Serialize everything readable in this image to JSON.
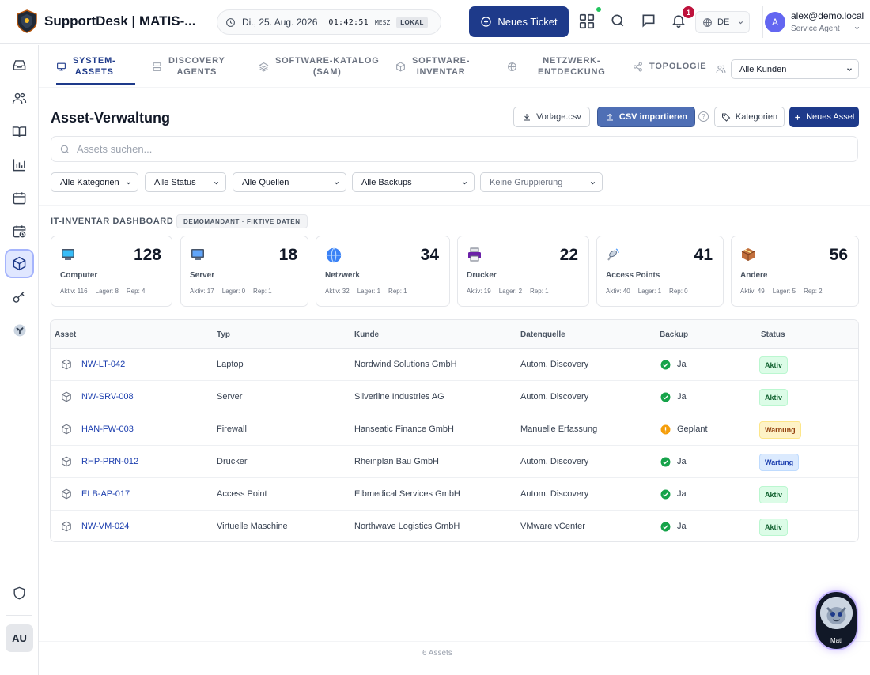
{
  "header": {
    "app_title": "SupportDesk | MATIS-...",
    "date": "Di., 25. Aug. 2026",
    "time": "01:42:51",
    "timezone": "MESZ",
    "local_label": "LOKAL",
    "new_ticket_label": "Neues Ticket",
    "notification_count": "1",
    "language": "DE",
    "user_avatar": "A",
    "user_email": "alex@demo.local",
    "user_role": "Service Agent"
  },
  "sidebar": {
    "items": [
      "inbox-icon",
      "users-icon",
      "book-icon",
      "chart-icon",
      "calendar-icon",
      "calendar-clock-icon",
      "cube-icon",
      "key-icon",
      "bot-icon"
    ],
    "bottom": [
      "shield-icon"
    ],
    "avatar": "AU"
  },
  "tabs": [
    {
      "line1": "SYSTEM-",
      "line2": "ASSETS",
      "icon": "monitor-icon",
      "active": true
    },
    {
      "line1": "DISCOVERY",
      "line2": "AGENTS",
      "icon": "server-icon"
    },
    {
      "line1": "SOFTWARE-KATALOG",
      "line2": "(SAM)",
      "icon": "layers-icon"
    },
    {
      "line1": "SOFTWARE-",
      "line2": "INVENTAR",
      "icon": "box-icon"
    },
    {
      "line1": "NETZWERK-",
      "line2": "ENTDECKUNG",
      "icon": "globe-icon"
    },
    {
      "line1": "TOPOLOGIE",
      "line2": "",
      "icon": "share-icon"
    }
  ],
  "customer_select": "Alle Kunden",
  "page": {
    "title": "Asset-Verwaltung",
    "btn_template": "Vorlage.csv",
    "btn_import": "CSV importieren",
    "help": "?",
    "btn_categories": "Kategorien",
    "btn_new_asset": "Neues Asset",
    "search_placeholder": "Assets suchen..."
  },
  "filters": [
    "Alle Kategorien",
    "Alle Status",
    "Alle Quellen",
    "Alle Backups",
    "Keine Gruppierung"
  ],
  "dashboard": {
    "title": "IT-INVENTAR DASHBOARD",
    "badge": "DEMOMANDANT · FIKTIVE DATEN",
    "cards": [
      {
        "label": "Computer",
        "count": "128",
        "aktiv": "Aktiv: 116",
        "lager": "Lager: 8",
        "rep": "Rep: 4",
        "icon": "computer-icon"
      },
      {
        "label": "Server",
        "count": "18",
        "aktiv": "Aktiv: 17",
        "lager": "Lager: 0",
        "rep": "Rep: 1",
        "icon": "server-monitor-icon"
      },
      {
        "label": "Netzwerk",
        "count": "34",
        "aktiv": "Aktiv: 32",
        "lager": "Lager: 1",
        "rep": "Rep: 1",
        "icon": "globe-icon"
      },
      {
        "label": "Drucker",
        "count": "22",
        "aktiv": "Aktiv: 19",
        "lager": "Lager: 2",
        "rep": "Rep: 1",
        "icon": "printer-icon"
      },
      {
        "label": "Access Points",
        "count": "41",
        "aktiv": "Aktiv: 40",
        "lager": "Lager: 1",
        "rep": "Rep: 0",
        "icon": "antenna-icon"
      },
      {
        "label": "Andere",
        "count": "56",
        "aktiv": "Aktiv: 49",
        "lager": "Lager: 5",
        "rep": "Rep: 2",
        "icon": "package-icon"
      }
    ]
  },
  "table": {
    "headers": [
      "Asset",
      "Typ",
      "Kunde",
      "Datenquelle",
      "Backup",
      "Status"
    ],
    "rows": [
      {
        "asset": "NW-LT-042",
        "typ": "Laptop",
        "kunde": "Nordwind Solutions GmbH",
        "quelle": "Autom. Discovery",
        "backup": "Ja",
        "backup_state": "ok",
        "status": "Aktiv",
        "status_kind": "aktiv"
      },
      {
        "asset": "NW-SRV-008",
        "typ": "Server",
        "kunde": "Silverline Industries AG",
        "quelle": "Autom. Discovery",
        "backup": "Ja",
        "backup_state": "ok",
        "status": "Aktiv",
        "status_kind": "aktiv"
      },
      {
        "asset": "HAN-FW-003",
        "typ": "Firewall",
        "kunde": "Hanseatic Finance GmbH",
        "quelle": "Manuelle Erfassung",
        "backup": "Geplant",
        "backup_state": "planned",
        "status": "Warnung",
        "status_kind": "warn"
      },
      {
        "asset": "RHP-PRN-012",
        "typ": "Drucker",
        "kunde": "Rheinplan Bau GmbH",
        "quelle": "Autom. Discovery",
        "backup": "Ja",
        "backup_state": "ok",
        "status": "Wartung",
        "status_kind": "wart"
      },
      {
        "asset": "ELB-AP-017",
        "typ": "Access Point",
        "kunde": "Elbmedical Services GmbH",
        "quelle": "Autom. Discovery",
        "backup": "Ja",
        "backup_state": "ok",
        "status": "Aktiv",
        "status_kind": "aktiv"
      },
      {
        "asset": "NW-VM-024",
        "typ": "Virtuelle Maschine",
        "kunde": "Northwave Logistics GmbH",
        "quelle": "VMware vCenter",
        "backup": "Ja",
        "backup_state": "ok",
        "status": "Aktiv",
        "status_kind": "aktiv"
      }
    ]
  },
  "footer": {
    "count": "6 Assets"
  },
  "assistant": {
    "label": "Mati"
  },
  "colors": {
    "primary": "#1e3a8a",
    "csv_button": "#4f6fb5",
    "success": "#16a34a",
    "warning": "#f59e0b"
  }
}
